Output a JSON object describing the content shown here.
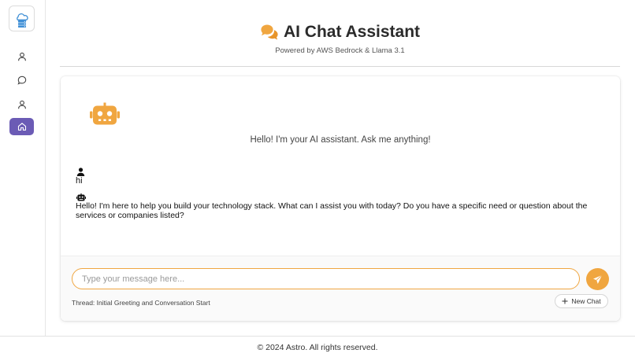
{
  "colors": {
    "accent": "#f0a640",
    "nav_active": "#6b5bb5",
    "logo_blue": "#3f8fd6"
  },
  "sidebar": {
    "logo_icon": "cloud-server-logo-icon",
    "items": [
      {
        "icon": "user-icon"
      },
      {
        "icon": "chat-bubble-icon"
      },
      {
        "icon": "user-icon"
      },
      {
        "icon": "home-icon",
        "active": true
      }
    ]
  },
  "header": {
    "icon": "chat-bubbles-icon",
    "title": "AI Chat Assistant",
    "subtitle": "Powered by AWS Bedrock & Llama 3.1"
  },
  "chat": {
    "welcome": "Hello! I'm your AI assistant. Ask me anything!",
    "messages": [
      {
        "role": "user",
        "icon": "user-icon",
        "text": "hi"
      },
      {
        "role": "assistant",
        "icon": "robot-icon",
        "text": "Hello! I'm here to help you build your technology stack. What can I assist you with today? Do you have a specific need or question about the services or companies listed?"
      }
    ]
  },
  "composer": {
    "placeholder": "Type your message here...",
    "value": "",
    "send_icon": "paper-plane-icon",
    "thread_label": "Thread: Initial Greeting and Conversation Start",
    "new_chat_label": "New Chat",
    "new_chat_icon": "plus-icon"
  },
  "footer": {
    "text": "© 2024 Astro. All rights reserved."
  }
}
